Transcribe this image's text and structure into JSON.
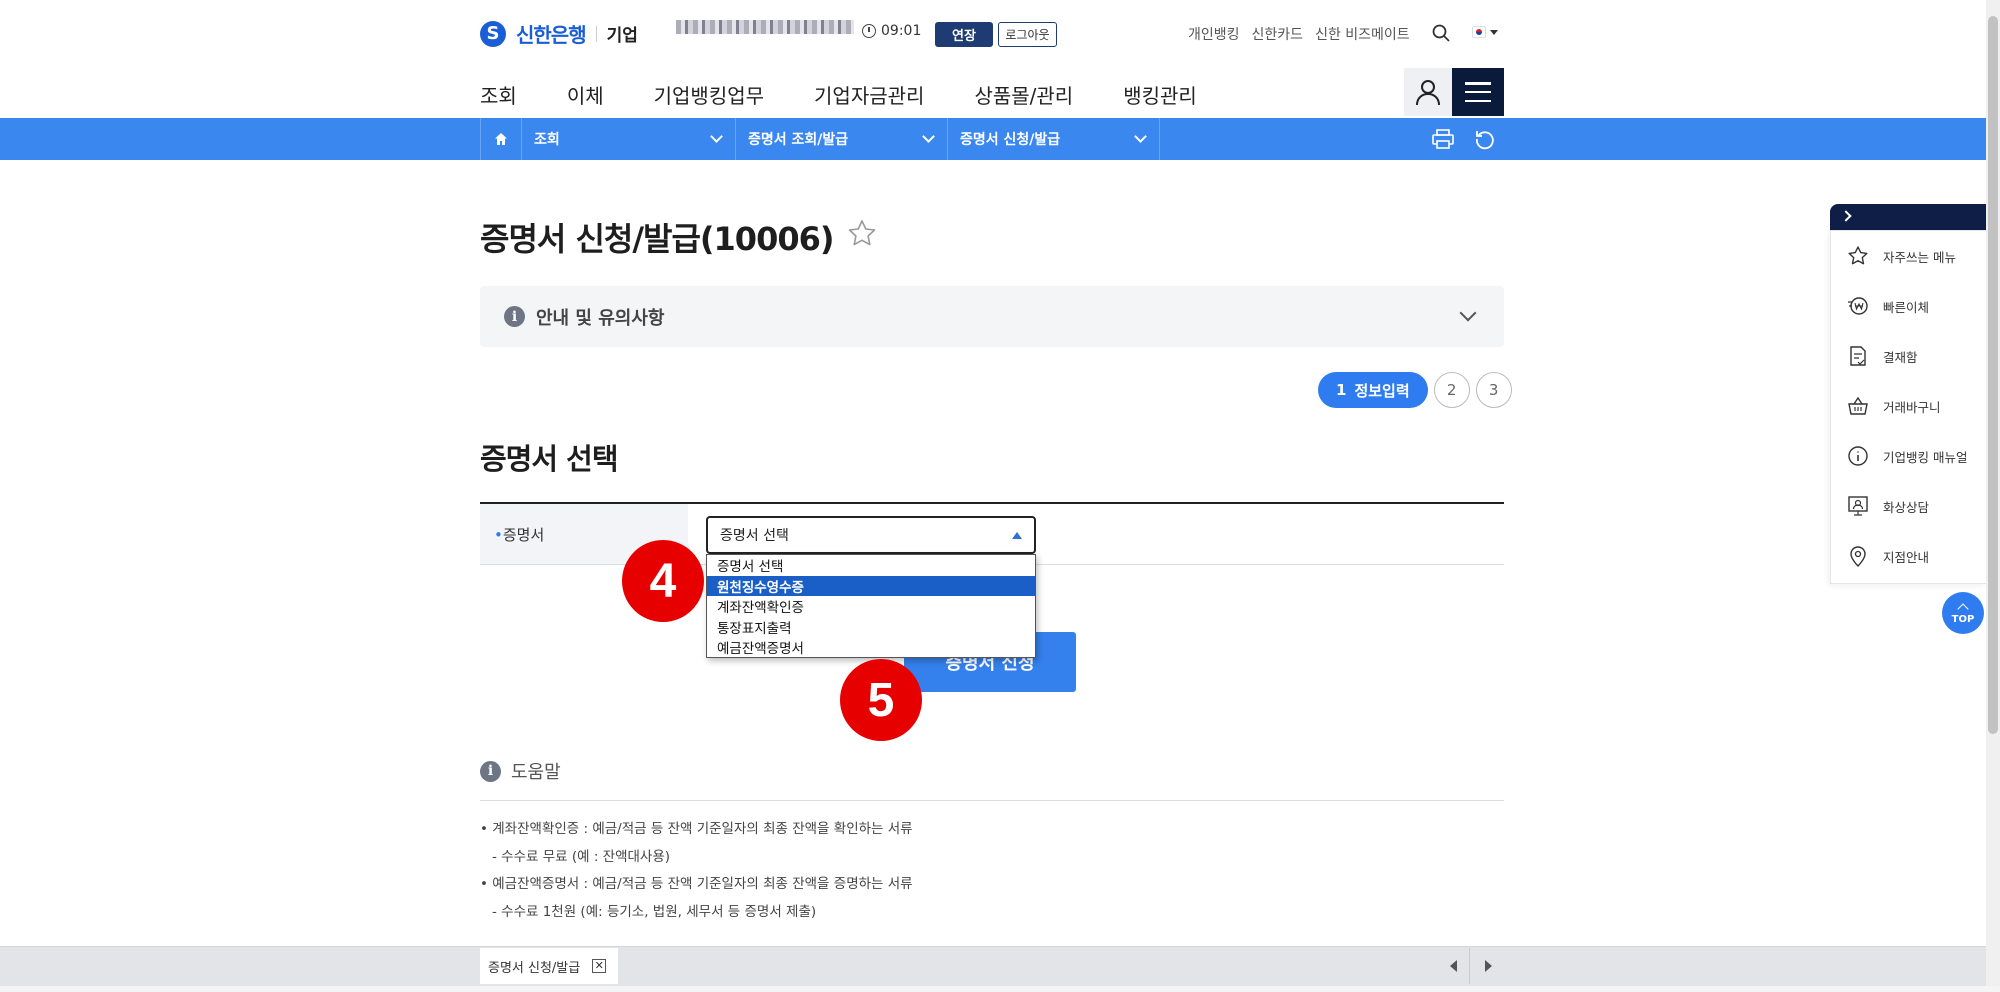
{
  "header": {
    "logo_text": "신한은행",
    "logo_sub": "기업",
    "clock_time": "09:01",
    "extend_label": "연장",
    "logout_label": "로그아웃",
    "util_links": [
      "개인뱅킹",
      "신한카드",
      "신한 비즈메이트"
    ],
    "gnb": [
      "조회",
      "이체",
      "기업뱅킹업무",
      "기업자금관리",
      "상품몰/관리",
      "뱅킹관리"
    ]
  },
  "breadcrumb": [
    "조회",
    "증명서 조회/발급",
    "증명서 신청/발급"
  ],
  "page": {
    "title": "증명서 신청/발급(10006)",
    "notice_label": "안내 및 유의사항",
    "steps": {
      "active_num": "1",
      "active_label": "정보입력",
      "others": [
        "2",
        "3"
      ]
    },
    "section_title": "증명서 선택",
    "form": {
      "required_mark": "•",
      "label": "증명서",
      "select_value": "증명서 선택",
      "options": [
        "증명서 선택",
        "원천징수영수증",
        "계좌잔액확인증",
        "통장표지출력",
        "예금잔액증명서"
      ],
      "highlighted_option_index": 1
    },
    "apply_button": "증명서 신청",
    "badges": [
      "4",
      "5"
    ],
    "help": {
      "title": "도움말",
      "lines": [
        "계좌잔액확인증 : 예금/적금 등 잔액 기준일자의 최종 잔액을 확인하는 서류",
        "- 수수료 무료 (예 : 잔액대사용)",
        "예금잔액증명서 : 예금/적금 등 잔액 기준일자의 최종 잔액을 증명하는 서류",
        "- 수수료 1천원 (예: 등기소, 법원, 세무서 등 증명서 제출)"
      ]
    }
  },
  "quick_menu": {
    "items": [
      "자주쓰는 메뉴",
      "빠른이체",
      "결재함",
      "거래바구니",
      "기업뱅킹 매뉴얼",
      "화상상담",
      "지점안내"
    ],
    "top_label": "TOP"
  },
  "bottom_tabs": {
    "active": "증명서 신청/발급"
  },
  "colors": {
    "brand": "#1a5ed7",
    "crumb_bar": "#3b87f0",
    "primary_button": "#3480ec",
    "badge": "#e60000",
    "navy": "#0f1e46"
  }
}
